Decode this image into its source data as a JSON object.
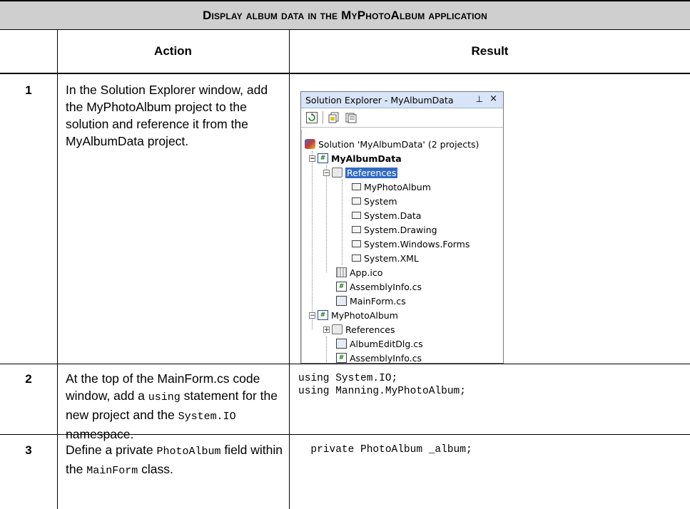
{
  "table": {
    "title": "Display album data in the MyPhotoAlbum application",
    "header": {
      "action": "Action",
      "result": "Result"
    }
  },
  "rows": [
    {
      "num": "1",
      "action": "In the Solution Explorer window, add the MyPhotoAlbum project to the solution and reference it from the MyAlbumData project."
    },
    {
      "num": "2",
      "action_parts": [
        "At the top of the MainForm.cs code window, add a ",
        "using",
        " statement for the new project and the ",
        "System.IO",
        " namespace."
      ],
      "code": [
        "using System.IO;",
        "using Manning.MyPhotoAlbum;"
      ]
    },
    {
      "num": "3",
      "action_parts": [
        "Define a private ",
        "PhotoAlbum",
        " field within the ",
        "MainForm",
        " class."
      ],
      "code": [
        "  private PhotoAlbum _album;"
      ]
    }
  ],
  "solution_explorer": {
    "title": "Solution Explorer - MyAlbumData",
    "pin_glyph": "⊥",
    "close_glyph": "×",
    "toolbar_icons": [
      "refresh-icon",
      "show-all-files-icon",
      "properties-icon"
    ],
    "tree": [
      {
        "label": "Solution 'MyAlbumData' (2 projects)",
        "icon": "solution-icon"
      },
      {
        "label": "MyAlbumData",
        "icon": "project-icon",
        "bold": true
      },
      {
        "label": "References",
        "icon": "references-folder-icon",
        "selected": true
      },
      {
        "label": "MyPhotoAlbum",
        "icon": "reference-icon"
      },
      {
        "label": "System",
        "icon": "reference-icon"
      },
      {
        "label": "System.Data",
        "icon": "reference-icon"
      },
      {
        "label": "System.Drawing",
        "icon": "reference-icon"
      },
      {
        "label": "System.Windows.Forms",
        "icon": "reference-icon"
      },
      {
        "label": "System.XML",
        "icon": "reference-icon"
      },
      {
        "label": "App.ico",
        "icon": "ico-file-icon"
      },
      {
        "label": "AssemblyInfo.cs",
        "icon": "cs-file-icon"
      },
      {
        "label": "MainForm.cs",
        "icon": "form-file-icon"
      },
      {
        "label": "MyPhotoAlbum",
        "icon": "project-icon"
      },
      {
        "label": "References",
        "icon": "references-folder-icon"
      },
      {
        "label": "AlbumEditDlg.cs",
        "icon": "form-file-icon"
      },
      {
        "label": "AssemblyInfo.cs",
        "icon": "cs-file-icon"
      }
    ]
  }
}
